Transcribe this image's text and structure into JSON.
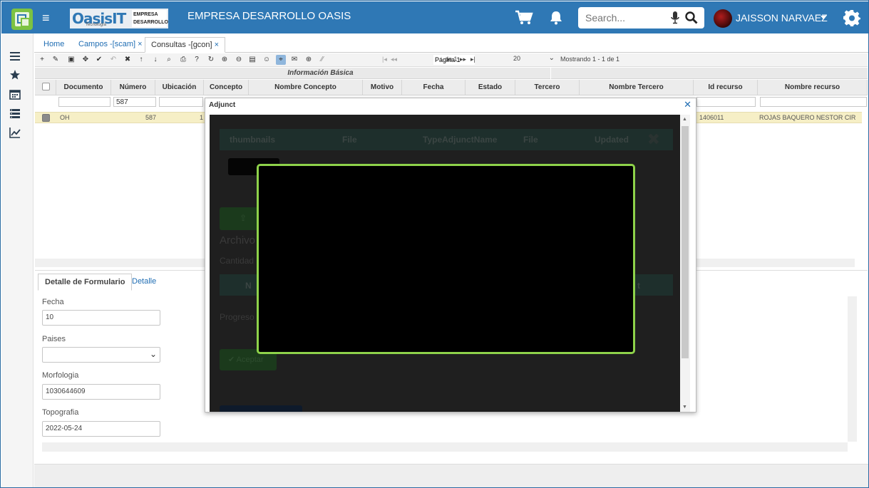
{
  "header": {
    "brand_name": "OasisIT",
    "brand_sub": "Tecnología",
    "brand_company_line1": "EMPRESA",
    "brand_company_line2": "DESARROLLO",
    "company": "EMPRESA DESARROLLO OASIS",
    "search_placeholder": "Search...",
    "user": "JAISSON NARVAEZ",
    "accent": "#2f78b5"
  },
  "tabs": [
    {
      "label": "Home"
    },
    {
      "label": "Campos -[scam]"
    },
    {
      "label": "Consultas -[gcon]"
    }
  ],
  "toolbar": {
    "page_label": "Página 1",
    "page_of": "de 1",
    "rows": "20",
    "showing": "Mostrando 1 - 1 de 1"
  },
  "grid": {
    "group": "Información Básica",
    "columns": [
      "Documento",
      "Número",
      "Ubicación",
      "Concepto",
      "Nombre Concepto",
      "Motivo",
      "Fecha",
      "Estado",
      "Tercero",
      "Nombre Tercero",
      "Id recurso",
      "Nombre recurso"
    ],
    "filter_numero": "587",
    "row": {
      "documento": "OH",
      "numero": "587",
      "ubicacion": "1",
      "id_recurso": "1406011",
      "nombre_recurso": "ROJAS BAQUERO NESTOR CIRU"
    }
  },
  "detail": {
    "tab_active": "Detalle de Formulario",
    "tab_other": "Detalle",
    "fields": [
      {
        "label": "Fecha",
        "value": "10"
      },
      {
        "label": "Paises",
        "value": ""
      },
      {
        "label": "Morfologia",
        "value": "1030644609"
      },
      {
        "label": "Topografia",
        "value": "2022-05-24"
      }
    ]
  },
  "modal": {
    "title": "Adjunct",
    "columns": [
      "thumbnails",
      "File",
      "TypeAdjunctName",
      "File",
      "Updated"
    ],
    "archivo_label": "Archivo",
    "cantidad_label": "Cantidad",
    "progreso_label": "Progreso",
    "second_bar_left": "N",
    "second_bar_right": "t",
    "accept_label": "Aceptar"
  }
}
